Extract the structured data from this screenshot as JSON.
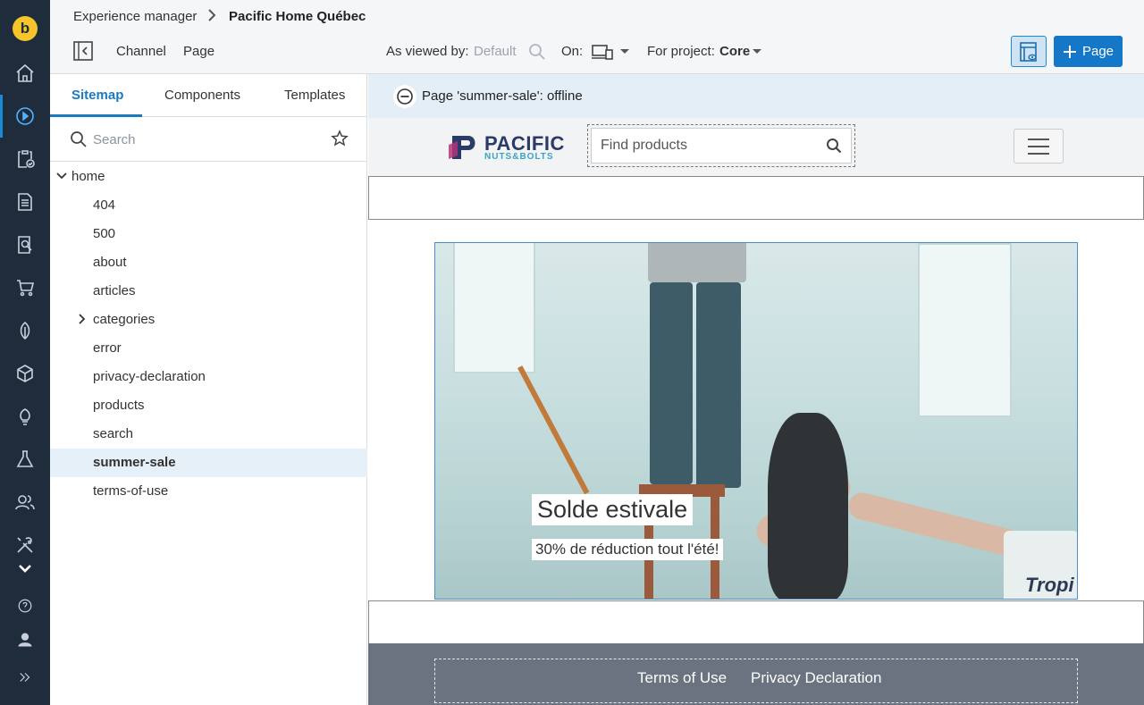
{
  "app": {
    "logo_letter": "b",
    "rail_icons": [
      "home-icon",
      "play-circle-icon",
      "clipboard-check-icon",
      "document-icon",
      "document-search-icon",
      "cart-icon",
      "leaf-icon",
      "cube-icon",
      "lightbulb-icon",
      "flask-icon",
      "users-icon",
      "tools-icon",
      "chevron-down-icon",
      "help-icon",
      "user-icon",
      "expand-icon"
    ],
    "accent": "#1a7ac0",
    "rail_bg": "#1f2c3b"
  },
  "breadcrumb": {
    "root": "Experience manager",
    "current": "Pacific Home Québec"
  },
  "toolbar": {
    "channel": "Channel",
    "page": "Page",
    "viewed_by_label": "As viewed by:",
    "viewed_by_value": "Default",
    "on_label": "On:",
    "project_label": "For project:",
    "project_value": "Core",
    "add_page_label": "Page"
  },
  "sidebar": {
    "tabs": [
      "Sitemap",
      "Components",
      "Templates"
    ],
    "search_placeholder": "Search",
    "tree": [
      {
        "label": "home"
      },
      {
        "label": "404"
      },
      {
        "label": "500"
      },
      {
        "label": "about"
      },
      {
        "label": "articles"
      },
      {
        "label": "categories"
      },
      {
        "label": "error"
      },
      {
        "label": "privacy-declaration"
      },
      {
        "label": "products"
      },
      {
        "label": "search"
      },
      {
        "label": "summer-sale"
      },
      {
        "label": "terms-of-use"
      }
    ]
  },
  "preview": {
    "status_text": "Page 'summer-sale': offline",
    "brand_main": "PACIFIC",
    "brand_sub": "NUTS&BOLTS",
    "find_placeholder": "Find products",
    "hero_title": "Solde estivale",
    "hero_subtitle": "30% de réduction tout l'été!",
    "bucket_text": "Tropi",
    "footer_links": [
      "Terms of Use",
      "Privacy Declaration"
    ]
  }
}
